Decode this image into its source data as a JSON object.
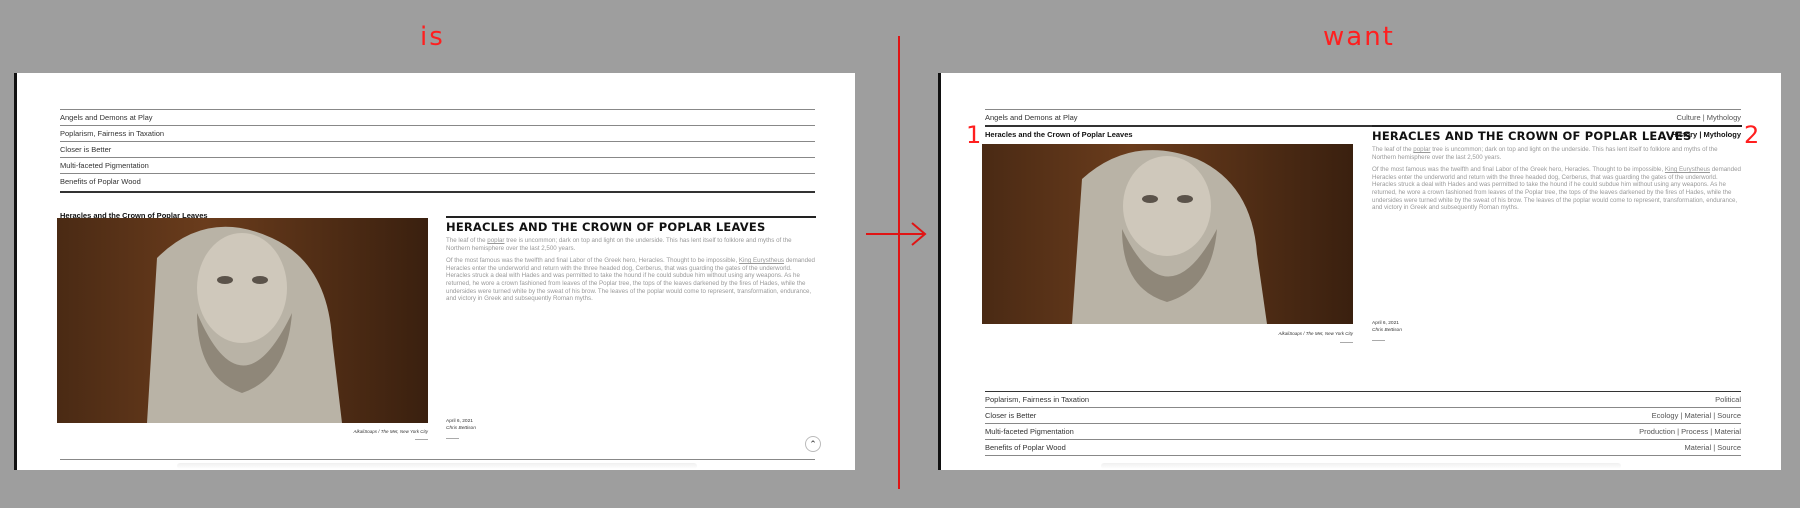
{
  "labels": {
    "left": "is",
    "right": "want"
  },
  "markers": {
    "one": "1",
    "two": "2"
  },
  "colors": {
    "accent": "#ff1f1f",
    "background": "#9e9e9e",
    "panel": "#ffffff"
  },
  "left_panel": {
    "list": [
      "Angels and Demons at Play",
      "Poplarism, Fairness in Taxation",
      "Closer is Better",
      "Multi-faceted Pigmentation",
      "Benefits of Poplar Wood"
    ],
    "current": "Heracles and the Crown of Poplar Leaves"
  },
  "right_panel": {
    "above": [
      {
        "title": "Angels and Demons at Play",
        "tags": "Culture | Mythology"
      }
    ],
    "current": {
      "title": "Heracles and the Crown of Poplar Leaves",
      "tags": "History | Mythology"
    },
    "below": [
      {
        "title": "Poplarism, Fairness in Taxation",
        "tags": "Political"
      },
      {
        "title": "Closer is Better",
        "tags": "Ecology | Material | Source"
      },
      {
        "title": "Multi-faceted Pigmentation",
        "tags": "Production | Process | Material"
      },
      {
        "title": "Benefits of Poplar Wood",
        "tags": "Material | Source"
      }
    ]
  },
  "article": {
    "title": "HERACLES AND THE CROWN OF POPLAR LEAVES",
    "p1_pre": "The leaf of the ",
    "p1_link": "poplar",
    "p1_post": " tree is uncommon; dark on top and light on the underside. This has lent itself to folklore and myths of the Northern hemisphere over the last 2,500 years.",
    "p2_pre": "Of the most famous was the twelfth and final Labor of the Greek hero, Heracles. Thought to be impossible, ",
    "p2_link": "King Eurystheus",
    "p2_post": " demanded Heracles enter the underworld and return with the three headed dog, Cerberus, that was guarding the gates of the underworld. Heracles struck a deal with Hades and was permitted to take the hound if he could subdue him without using any weapons. As he returned, he wore a crown fashioned from leaves of the Poplar tree, the tops of the leaves darkened by the fires of Hades, while the undersides were turned white by the sweat of his brow. The leaves of the poplar would come to represent, transformation, endurance, and victory in Greek and subsequently Roman myths.",
    "caption": "AlkaliSoaps / The Met, New York City",
    "date": "April 6, 2021",
    "author": "Chris Bettison"
  },
  "scroll_icon": "chevron-up-icon",
  "arrow_icon": "right-arrow-icon"
}
